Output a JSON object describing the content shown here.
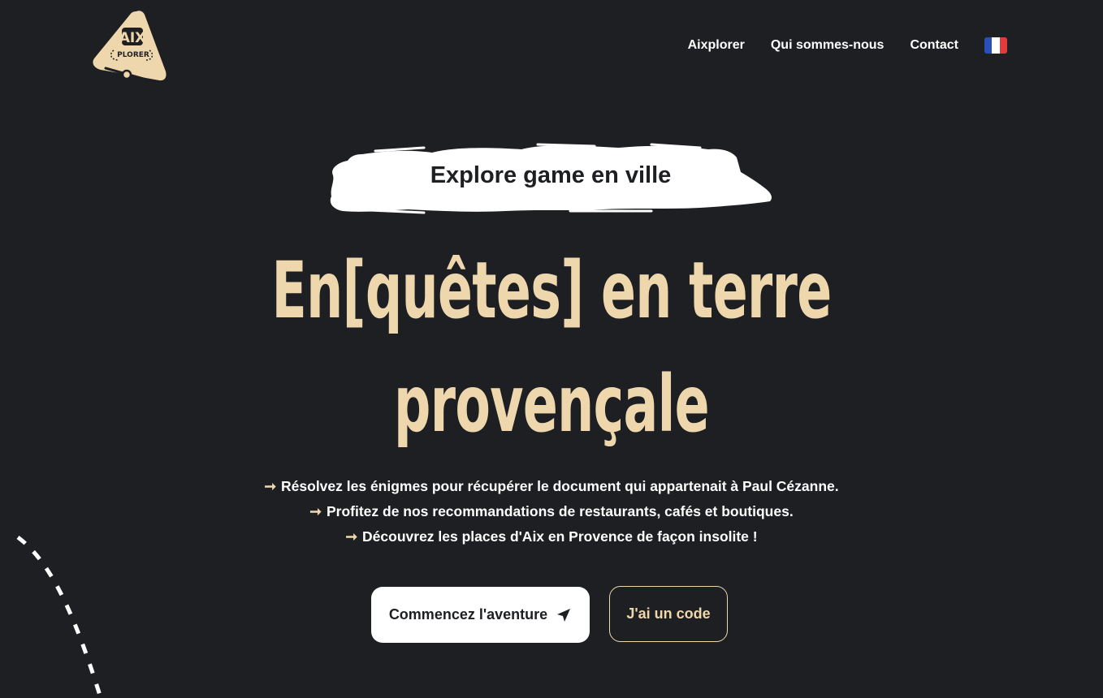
{
  "header": {
    "logo_text_top": "AIX",
    "logo_text_bottom": "PLORER",
    "nav": [
      {
        "label": "Aixplorer"
      },
      {
        "label": "Qui sommes-nous"
      },
      {
        "label": "Contact"
      }
    ],
    "language_flag": "flag-fr-icon"
  },
  "hero": {
    "tag": "Explore game en ville",
    "title_line1": "En[quêtes] en terre",
    "title_line2": "provençale",
    "bullets": [
      {
        "arrow": "➞",
        "text": "Résolvez les énigmes pour récupérer le document qui appartenait à Paul Cézanne."
      },
      {
        "arrow": "➞",
        "text": "Profitez de nos recommandations de restaurants, cafés et boutiques."
      },
      {
        "arrow": "➞",
        "text": "Découvrez les places d'Aix en Provence de façon insolite !"
      }
    ]
  },
  "buttons": {
    "primary_label": "Commencez l'aventure",
    "primary_icon": "paper-plane-icon",
    "secondary_label": "J'ai un code"
  },
  "colors": {
    "background": "#1d1f22",
    "accent": "#efd7ad",
    "text": "#ffffff",
    "flag_blue": "#2a4fb8",
    "flag_white": "#ffffff",
    "flag_red": "#e23b3b"
  }
}
